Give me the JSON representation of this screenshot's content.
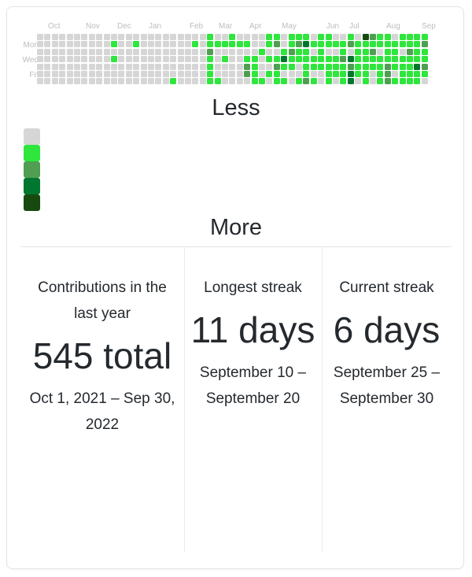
{
  "card": {
    "border_color": "#e4e4e4",
    "background": "#ffffff"
  },
  "calendar": {
    "month_labels": [
      "Oct",
      "Nov",
      "Dec",
      "Jan",
      "Feb",
      "Mar",
      "Apr",
      "May",
      "Jun",
      "Jul",
      "Aug",
      "Sep"
    ],
    "month_positions": [
      60,
      108,
      148,
      188,
      240,
      277,
      316,
      357,
      414,
      443,
      490,
      535
    ],
    "day_labels": [
      {
        "label": "Mon",
        "row": 1
      },
      {
        "label": "Wed",
        "row": 3
      },
      {
        "label": "Fri",
        "row": 5
      }
    ],
    "columns": 53,
    "rows": 7,
    "palette": [
      "#d6d6d6",
      "#2ee63c",
      "#4f9e52",
      "#00772f",
      "#174a0e"
    ],
    "levels": [
      [
        0,
        0,
        0,
        0,
        0,
        0,
        0
      ],
      [
        0,
        0,
        0,
        0,
        0,
        0,
        0
      ],
      [
        0,
        0,
        0,
        0,
        0,
        0,
        0
      ],
      [
        0,
        0,
        0,
        0,
        0,
        0,
        0
      ],
      [
        0,
        0,
        0,
        0,
        0,
        0,
        0
      ],
      [
        0,
        0,
        0,
        0,
        0,
        0,
        0
      ],
      [
        0,
        0,
        0,
        0,
        0,
        0,
        0
      ],
      [
        0,
        0,
        0,
        0,
        0,
        0,
        0
      ],
      [
        0,
        0,
        0,
        0,
        0,
        0,
        0
      ],
      [
        0,
        0,
        0,
        0,
        0,
        0,
        0
      ],
      [
        0,
        1,
        0,
        1,
        0,
        0,
        0
      ],
      [
        0,
        0,
        0,
        0,
        0,
        0,
        0
      ],
      [
        0,
        0,
        0,
        0,
        0,
        0,
        0
      ],
      [
        0,
        1,
        0,
        0,
        0,
        0,
        0
      ],
      [
        0,
        0,
        0,
        0,
        0,
        0,
        0
      ],
      [
        0,
        0,
        0,
        0,
        0,
        0,
        0
      ],
      [
        0,
        0,
        0,
        0,
        0,
        0,
        0
      ],
      [
        0,
        0,
        0,
        0,
        0,
        0,
        0
      ],
      [
        0,
        0,
        0,
        0,
        0,
        0,
        1
      ],
      [
        0,
        0,
        0,
        0,
        0,
        0,
        0
      ],
      [
        0,
        0,
        0,
        0,
        0,
        0,
        0
      ],
      [
        0,
        1,
        0,
        0,
        0,
        0,
        0
      ],
      [
        0,
        0,
        0,
        0,
        0,
        0,
        0
      ],
      [
        1,
        1,
        2,
        1,
        1,
        1,
        1
      ],
      [
        0,
        1,
        0,
        0,
        0,
        0,
        1
      ],
      [
        0,
        1,
        0,
        1,
        0,
        0,
        0
      ],
      [
        1,
        1,
        0,
        0,
        0,
        0,
        0
      ],
      [
        0,
        1,
        0,
        0,
        0,
        0,
        0
      ],
      [
        0,
        1,
        0,
        1,
        2,
        2,
        0
      ],
      [
        0,
        0,
        0,
        1,
        1,
        1,
        1
      ],
      [
        0,
        0,
        1,
        0,
        0,
        0,
        1
      ],
      [
        1,
        1,
        0,
        1,
        0,
        1,
        0
      ],
      [
        1,
        2,
        0,
        1,
        2,
        1,
        1
      ],
      [
        0,
        0,
        1,
        3,
        1,
        0,
        1
      ],
      [
        1,
        1,
        2,
        1,
        1,
        0,
        0
      ],
      [
        1,
        2,
        1,
        1,
        0,
        0,
        1
      ],
      [
        1,
        3,
        1,
        1,
        1,
        1,
        2
      ],
      [
        0,
        1,
        0,
        1,
        1,
        0,
        1
      ],
      [
        1,
        1,
        1,
        1,
        1,
        0,
        0
      ],
      [
        1,
        1,
        0,
        1,
        1,
        1,
        1
      ],
      [
        0,
        1,
        0,
        1,
        1,
        1,
        0
      ],
      [
        0,
        1,
        1,
        2,
        1,
        1,
        1
      ],
      [
        1,
        2,
        0,
        3,
        2,
        3,
        3
      ],
      [
        0,
        1,
        1,
        1,
        1,
        1,
        0
      ],
      [
        4,
        1,
        1,
        1,
        1,
        1,
        1
      ],
      [
        2,
        1,
        2,
        1,
        1,
        0,
        0
      ],
      [
        1,
        1,
        0,
        1,
        1,
        1,
        1
      ],
      [
        1,
        1,
        1,
        1,
        2,
        2,
        2
      ],
      [
        0,
        1,
        1,
        1,
        1,
        0,
        1
      ],
      [
        1,
        1,
        0,
        1,
        1,
        1,
        1
      ],
      [
        1,
        1,
        2,
        1,
        1,
        1,
        1
      ],
      [
        1,
        1,
        1,
        1,
        3,
        1,
        1
      ],
      [
        1,
        2,
        1,
        1,
        2,
        1,
        0
      ]
    ]
  },
  "legend": {
    "less_label": "Less",
    "more_label": "More",
    "swatch_colors": [
      "#d6d6d6",
      "#2ee63c",
      "#4f9e52",
      "#00772f",
      "#174a0e"
    ]
  },
  "stats": {
    "columns": [
      {
        "title": "Contributions in the last year",
        "value": "545 total",
        "range": "Oct 1, 2021 – Sep 30, 2022",
        "name": "contributions"
      },
      {
        "title": "Longest streak",
        "value": "11 days",
        "range": "September 10 – September 20",
        "name": "longest-streak"
      },
      {
        "title": "Current streak",
        "value": "6 days",
        "range": "September 25 – September 30",
        "name": "current-streak"
      }
    ]
  }
}
